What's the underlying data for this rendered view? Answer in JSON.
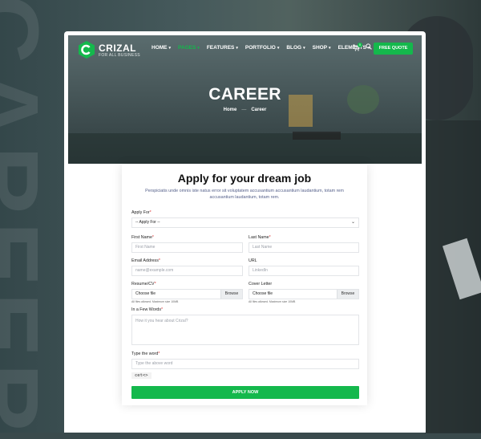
{
  "background": {
    "watermark": "CAREER"
  },
  "brand": {
    "name": "CRIZAL",
    "tagline": "FOR ALL BUSINESS",
    "accent": "#14b84c"
  },
  "nav": {
    "items": [
      {
        "label": "HOME",
        "active": false
      },
      {
        "label": "PAGES",
        "active": true
      },
      {
        "label": "FEATURES",
        "active": false
      },
      {
        "label": "PORTFOLIO",
        "active": false
      },
      {
        "label": "BLOG",
        "active": false
      },
      {
        "label": "SHOP",
        "active": false
      },
      {
        "label": "ELEMENTS",
        "active": false
      }
    ],
    "cart_count": "0",
    "cta": "FREE QUOTE"
  },
  "hero": {
    "title": "CAREER",
    "breadcrumb": [
      "Home",
      "Career"
    ]
  },
  "form": {
    "title": "Apply for your dream job",
    "intro": "Perspiciatis unde omnis iste natus error sit voluptatem accusantium accusantium laudantium, totam rem accusantium laudantium, totam rem.",
    "apply_for": {
      "label": "Apply For",
      "value": "-- Apply For --"
    },
    "first_name": {
      "label": "First Name",
      "placeholder": "First Name"
    },
    "last_name": {
      "label": "Last Name",
      "placeholder": "Last Name"
    },
    "email": {
      "label": "Email Address",
      "placeholder": "name@example.com"
    },
    "url": {
      "label": "URL",
      "placeholder": "LinkedIn"
    },
    "resume": {
      "label": "Resume/CV",
      "choose": "Choose file",
      "browse": "Browse",
      "hint": "All files allowed. Maximum size 10MB"
    },
    "cover": {
      "label": "Cover Letter",
      "choose": "Choose file",
      "browse": "Browse",
      "hint": "All files allowed. Maximum size 10MB"
    },
    "words": {
      "label": "In a Few Words",
      "placeholder": "How it you hear about Crizal?"
    },
    "captcha": {
      "label": "Type the word",
      "placeholder": "Type the above word",
      "word": "cet<>"
    },
    "submit": "APPLY NOW"
  }
}
